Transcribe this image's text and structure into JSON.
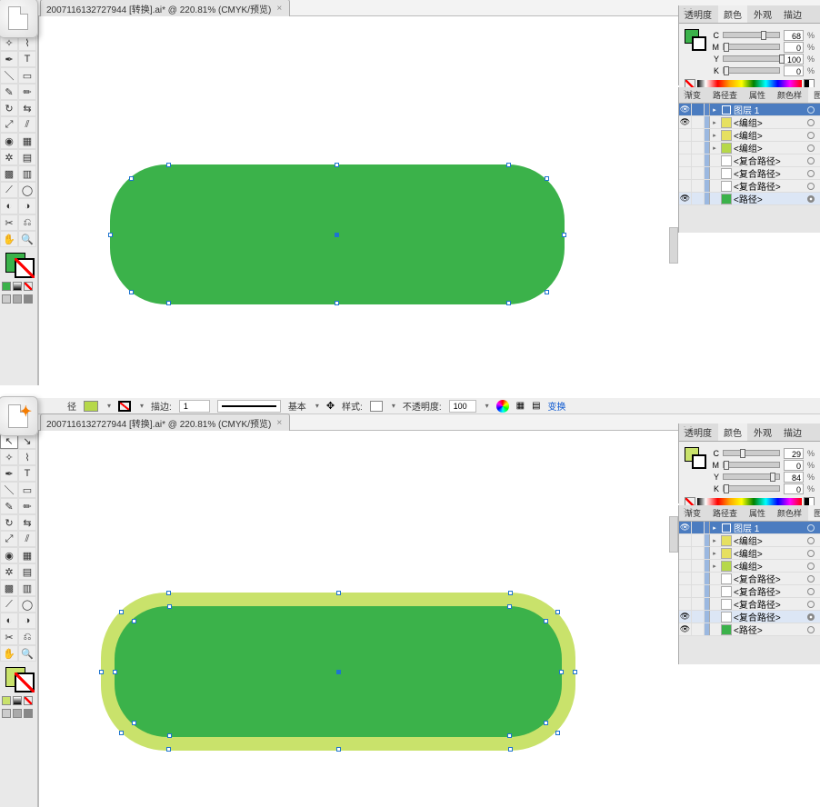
{
  "doc_title": "2007116132727944  [转换].ai* @ 220.81% (CMYK/预览)",
  "topbar": {
    "path_label": "径",
    "stroke_label": "描边:",
    "stroke_pt": "1",
    "basic_label": "基本",
    "style_label": "样式:",
    "opacity_label": "不透明度:",
    "opacity_val": "100",
    "transform_label": "变换"
  },
  "color_tabs": [
    "透明度",
    "颜色",
    "外观",
    "描边"
  ],
  "layer_tabs": [
    "渐变",
    "路径查",
    "属性",
    "颜色样",
    "图层"
  ],
  "cmyk1": {
    "C": "68",
    "M": "0",
    "Y": "100",
    "K": "0"
  },
  "cmyk2": {
    "C": "29",
    "M": "0",
    "Y": "84",
    "K": "0"
  },
  "layers1": {
    "header": "图层 1",
    "items": [
      {
        "name": "<编组>",
        "thumb": "#e6e060",
        "eye": true,
        "tog": true
      },
      {
        "name": "<编组>",
        "thumb": "#e6e060",
        "eye": false,
        "tog": true
      },
      {
        "name": "<编组>",
        "thumb": "#b6d84a",
        "eye": false,
        "tog": true
      },
      {
        "name": "<复合路径>",
        "thumb": "#fff",
        "eye": false,
        "tog": false
      },
      {
        "name": "<复合路径>",
        "thumb": "#fff",
        "eye": false,
        "tog": false
      },
      {
        "name": "<复合路径>",
        "thumb": "#fff",
        "eye": false,
        "tog": false
      },
      {
        "name": "<路径>",
        "thumb": "#3bb24a",
        "eye": true,
        "tog": false,
        "sel": true
      }
    ]
  },
  "layers2": {
    "header": "图层 1",
    "items": [
      {
        "name": "<编组>",
        "thumb": "#e6e060",
        "eye": false,
        "tog": true
      },
      {
        "name": "<编组>",
        "thumb": "#e6e060",
        "eye": false,
        "tog": true
      },
      {
        "name": "<编组>",
        "thumb": "#b6d84a",
        "eye": false,
        "tog": true
      },
      {
        "name": "<复合路径>",
        "thumb": "#fff",
        "eye": false,
        "tog": false
      },
      {
        "name": "<复合路径>",
        "thumb": "#fff",
        "eye": false,
        "tog": false
      },
      {
        "name": "<复合路径>",
        "thumb": "#fff",
        "eye": false,
        "tog": false
      },
      {
        "name": "<复合路径>",
        "thumb": "#fff",
        "eye": true,
        "tog": false,
        "sel": true
      },
      {
        "name": "<路径>",
        "thumb": "#3bb24a",
        "eye": true,
        "tog": false
      }
    ]
  },
  "colors": {
    "fill1": "#3bb24a",
    "fill2": "#c9e26b",
    "inner": "#3bb24a"
  },
  "slider_labels": {
    "C": "C",
    "M": "M",
    "Y": "Y",
    "K": "K",
    "pct": "%"
  }
}
